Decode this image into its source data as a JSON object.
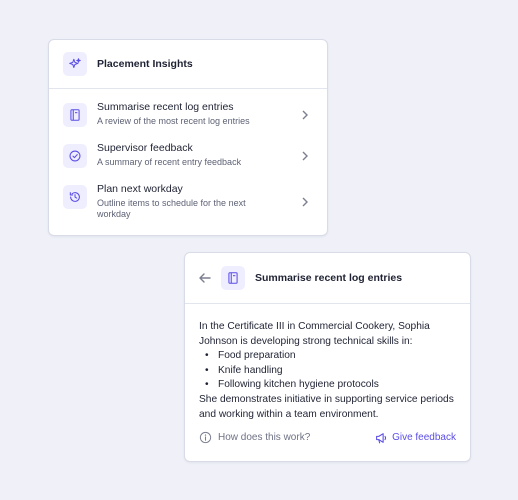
{
  "insights_panel": {
    "title": "Placement Insights",
    "items": [
      {
        "title": "Summarise recent log entries",
        "subtitle": "A review of the most recent log entries",
        "icon": "notebook-icon"
      },
      {
        "title": "Supervisor feedback",
        "subtitle": "A summary of recent entry feedback",
        "icon": "check-circle-icon"
      },
      {
        "title": "Plan next workday",
        "subtitle": "Outline items to schedule for the next workday",
        "icon": "history-icon"
      }
    ]
  },
  "summary_panel": {
    "title": "Summarise recent log entries",
    "intro": "In the Certificate III in Commercial Cookery, Sophia Johnson is developing strong technical skills in:",
    "bullets": [
      "Food preparation",
      "Knife handling",
      "Following kitchen hygiene protocols"
    ],
    "closing": "She demonstrates initiative in supporting service periods and working within a team environment.",
    "help_link": "How does this work?",
    "feedback_link": "Give feedback"
  },
  "colors": {
    "background": "#eff0f8",
    "accent": "#5b4ee6",
    "icon_tile": "#efeefe"
  }
}
